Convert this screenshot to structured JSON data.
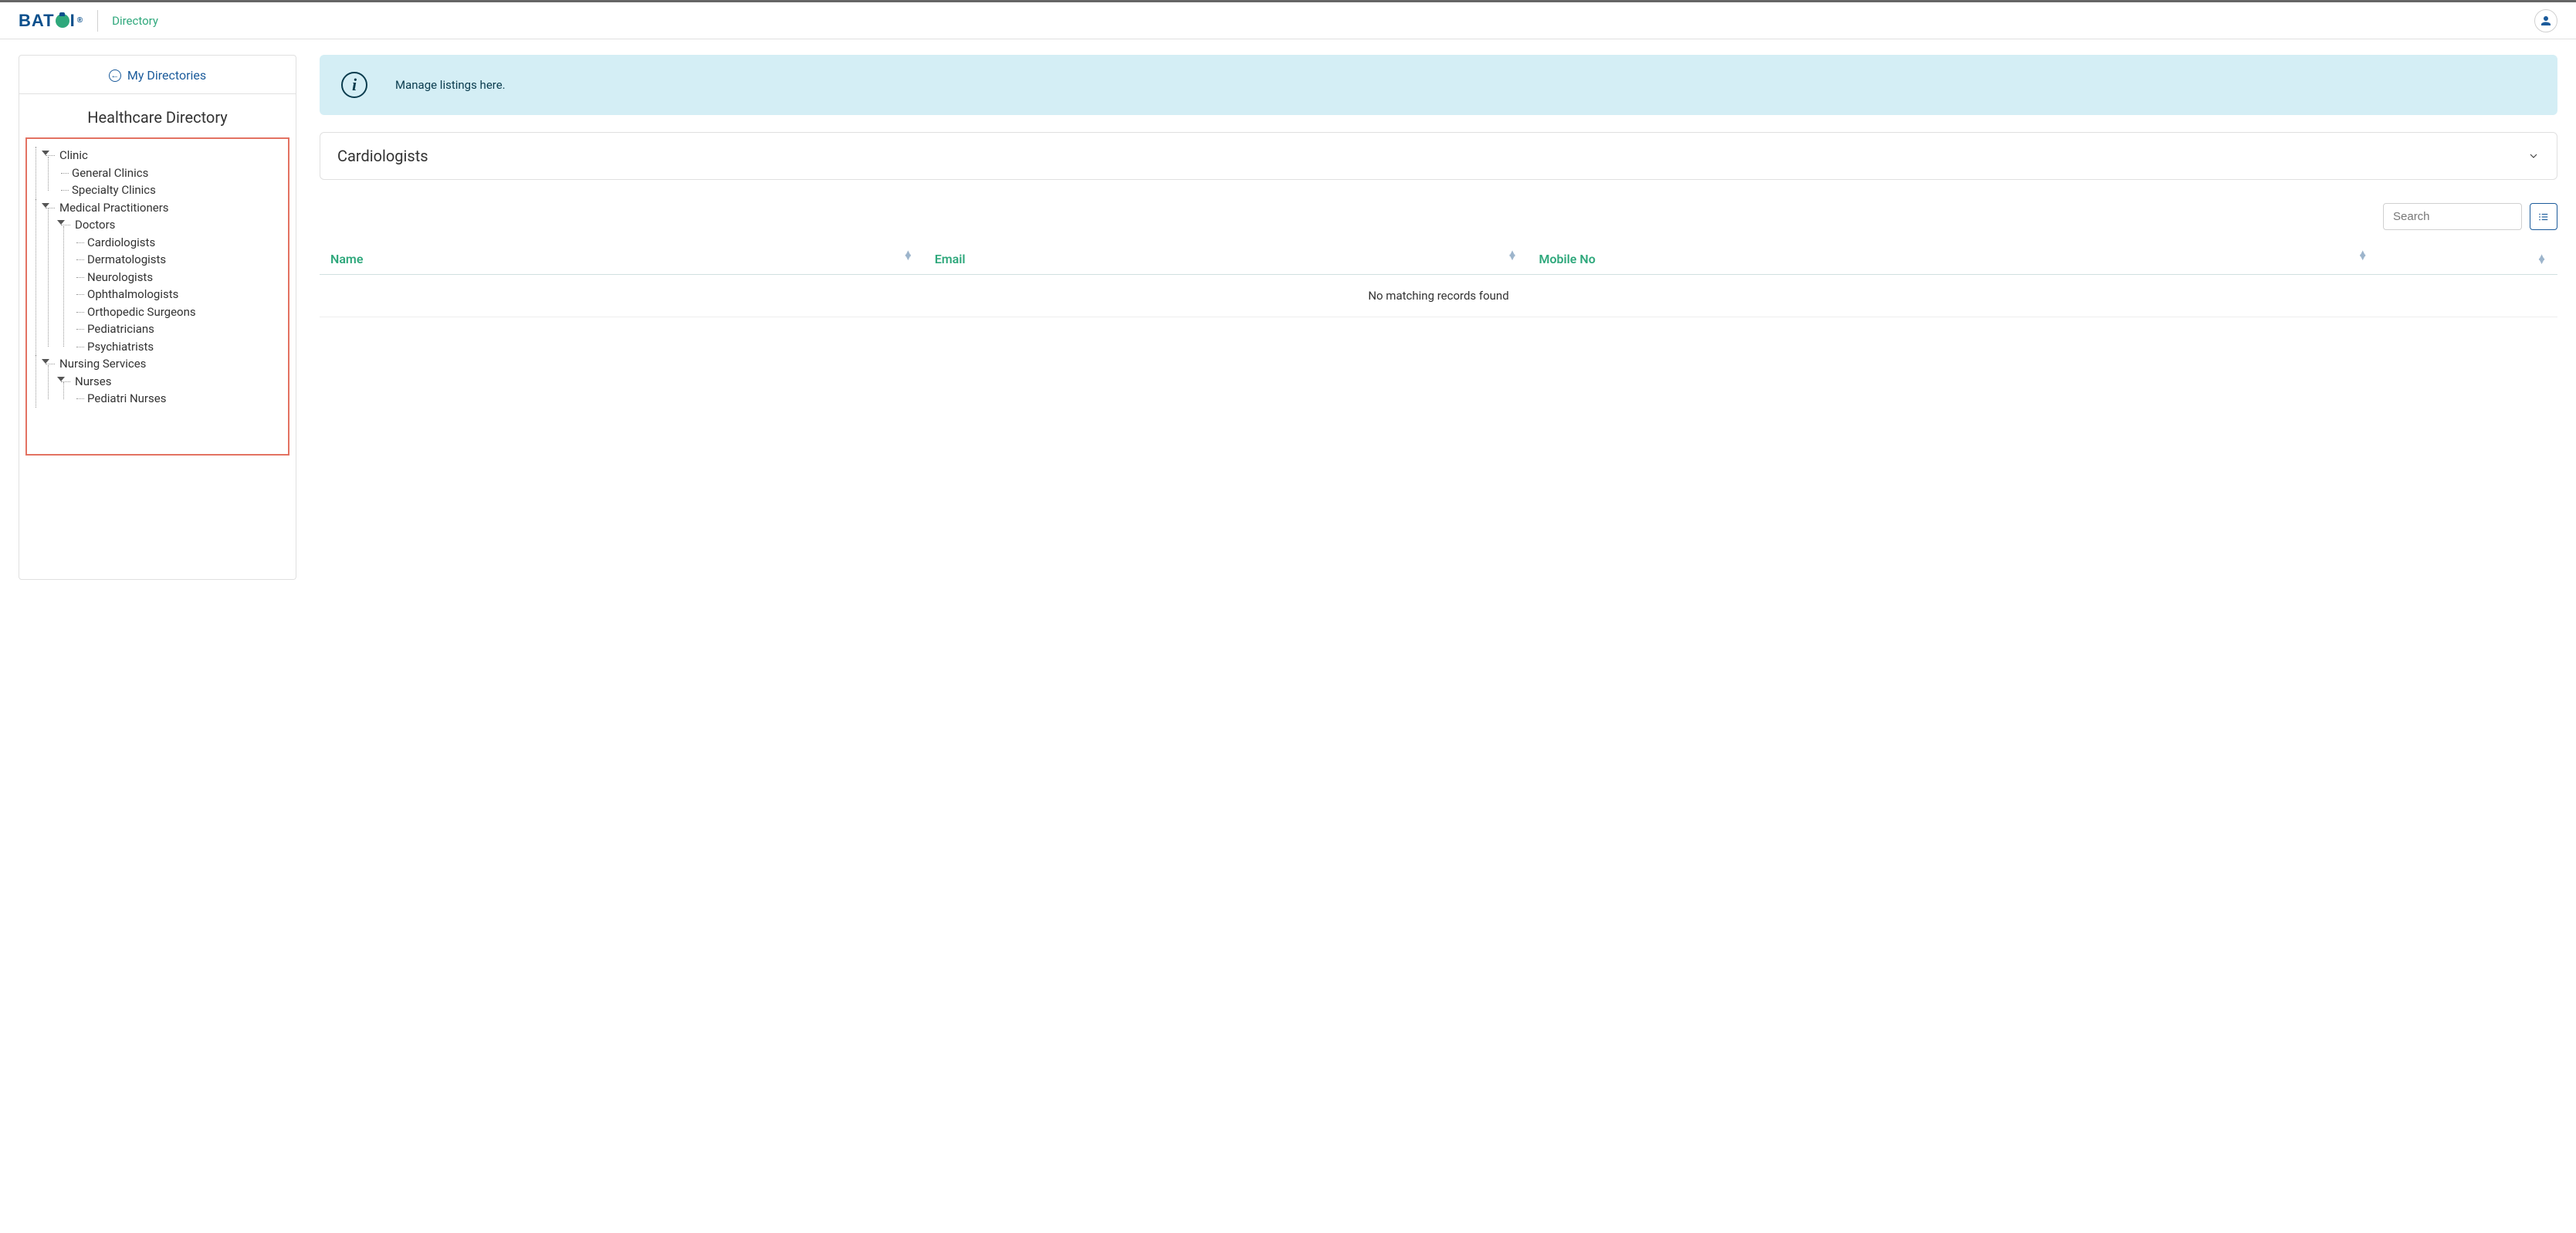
{
  "header": {
    "logo_text_1": "BAT",
    "logo_text_2": "I",
    "nav_link": "Directory"
  },
  "sidebar": {
    "my_directories_label": "My Directories",
    "directory_title": "Healthcare Directory",
    "tree": {
      "clinic": {
        "label": "Clinic",
        "children": {
          "general": "General Clinics",
          "specialty": "Specialty Clinics"
        }
      },
      "medical": {
        "label": "Medical Practitioners",
        "doctors": {
          "label": "Doctors",
          "children": {
            "cardiologists": "Cardiologists",
            "dermatologists": "Dermatologists",
            "neurologists": "Neurologists",
            "ophthalmologists": "Ophthalmologists",
            "orthopedic": "Orthopedic Surgeons",
            "pediatricians": "Pediatricians",
            "psychiatrists": "Psychiatrists"
          }
        }
      },
      "nursing": {
        "label": "Nursing Services",
        "nurses": {
          "label": "Nurses",
          "children": {
            "pediatric": "Pediatri Nurses"
          }
        }
      }
    }
  },
  "content": {
    "info_banner_text": "Manage listings here.",
    "category_title": "Cardiologists",
    "search_placeholder": "Search",
    "table": {
      "col_name": "Name",
      "col_email": "Email",
      "col_mobile": "Mobile No",
      "empty_message": "No matching records found"
    }
  }
}
